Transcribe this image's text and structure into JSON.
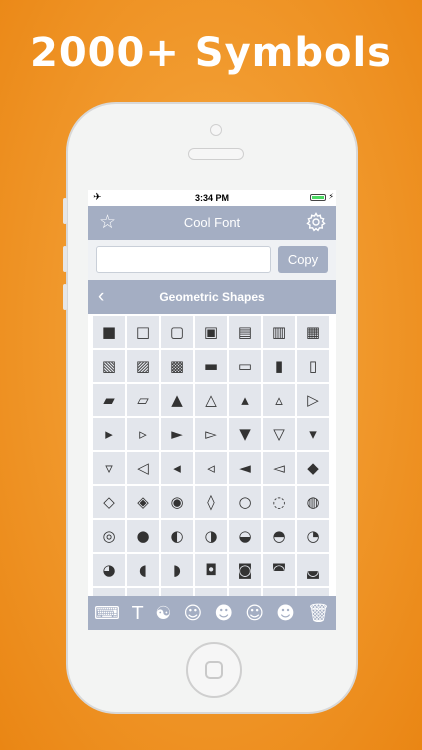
{
  "headline": "2000+ Symbols",
  "status_bar": {
    "time": "3:34 PM",
    "airplane": "✈",
    "charging": "⚡"
  },
  "nav": {
    "title": "Cool Font",
    "left_icon": "star-icon",
    "right_icon": "gear-icon"
  },
  "input": {
    "value": "",
    "placeholder": ""
  },
  "copy_label": "Copy",
  "category": {
    "title": "Geometric Shapes",
    "back_glyph": "‹"
  },
  "symbols": [
    "■",
    "□",
    "▢",
    "▣",
    "▤",
    "▥",
    "▦",
    "▧",
    "▨",
    "▩",
    "▬",
    "▭",
    "▮",
    "▯",
    "▰",
    "▱",
    "▲",
    "△",
    "▴",
    "▵",
    "▷",
    "▸",
    "▹",
    "►",
    "▻",
    "▼",
    "▽",
    "▾",
    "▿",
    "◁",
    "◂",
    "◃",
    "◄",
    "◅",
    "◆",
    "◇",
    "◈",
    "◉",
    "◊",
    "○",
    "◌",
    "◍",
    "◎",
    "●",
    "◐",
    "◑",
    "◒",
    "◓",
    "◔",
    "◕",
    "◖",
    "◗",
    "◘",
    "◙",
    "◚",
    "◛",
    "◜",
    "◝",
    "◞",
    "◟",
    "◠",
    "◡",
    "◢"
  ],
  "toolbar": [
    {
      "name": "keyboard-icon",
      "glyph": "⌨"
    },
    {
      "name": "text-icon",
      "glyph": "T"
    },
    {
      "name": "yin-yang-icon",
      "glyph": "☯"
    },
    {
      "name": "smiley-icon",
      "glyph": "☺"
    },
    {
      "name": "robot-face-icon",
      "glyph": "☻"
    },
    {
      "name": "grin-icon",
      "glyph": "☺"
    },
    {
      "name": "tongue-face-icon",
      "glyph": "☻"
    },
    {
      "name": "trash-icon",
      "glyph": "🗑"
    }
  ],
  "colors": {
    "accent": "#a4aec3",
    "cell": "#e3e6ec",
    "background": "#f19a2e"
  }
}
